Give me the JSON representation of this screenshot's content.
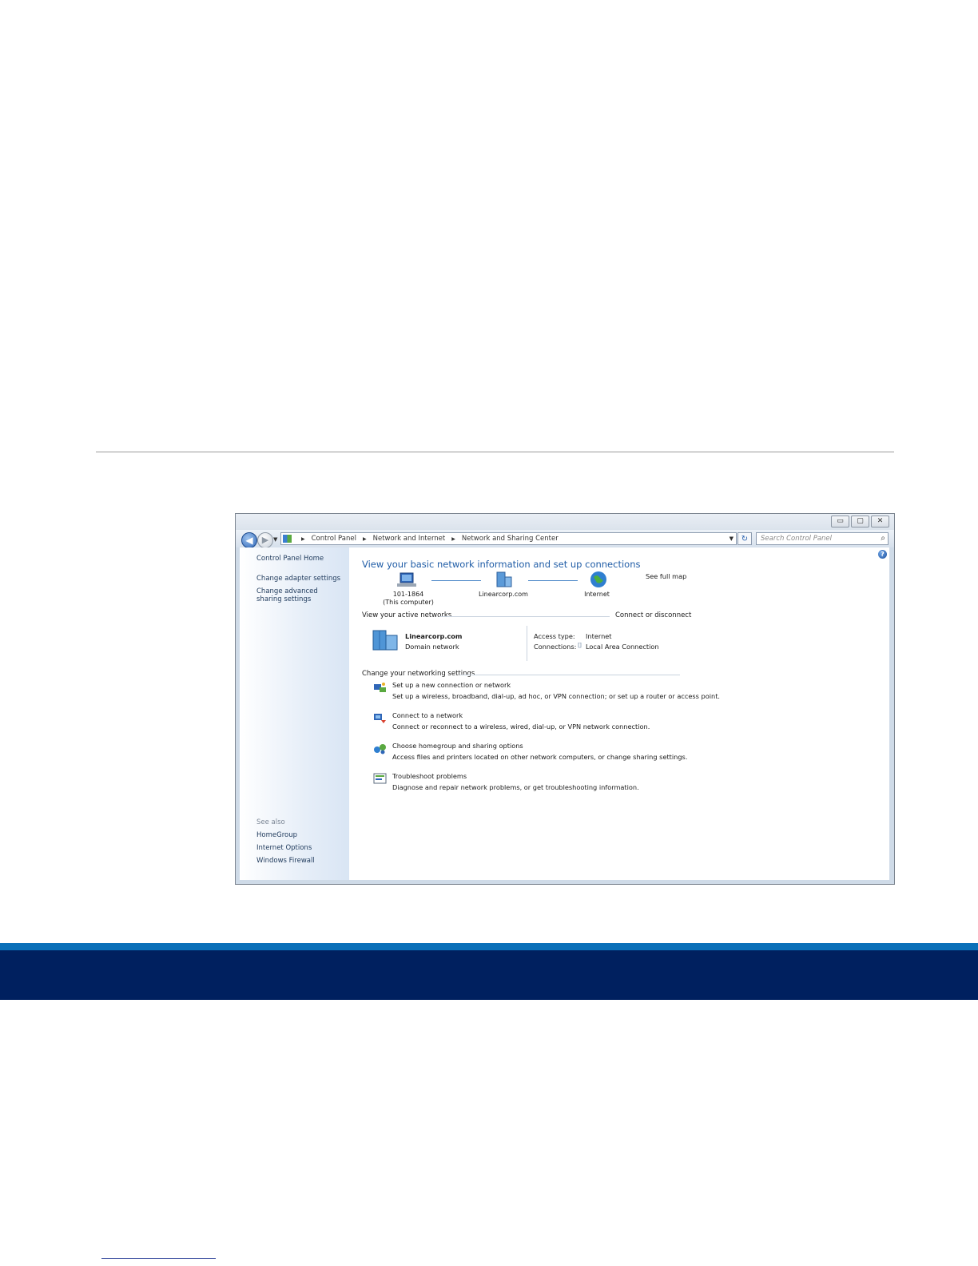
{
  "window": {
    "buttons": {
      "minimize": "▭",
      "maximize": "▢",
      "close": "✕"
    }
  },
  "address": {
    "crumbs": [
      "Control Panel",
      "Network and Internet",
      "Network and Sharing Center"
    ],
    "search_placeholder": "Search Control Panel"
  },
  "sidebar": {
    "home": "Control Panel Home",
    "links": [
      "Change adapter settings",
      "Change advanced sharing settings"
    ],
    "see_also_label": "See also",
    "see_also": [
      "HomeGroup",
      "Internet Options",
      "Windows Firewall"
    ]
  },
  "main": {
    "title": "View your basic network information and set up connections",
    "see_full_map": "See full map",
    "map": {
      "computer_name": "101-1864",
      "computer_sub": "(This computer)",
      "network": "Linearcorp.com",
      "internet": "Internet"
    },
    "active_networks": {
      "label": "View your active networks",
      "connect_link": "Connect or disconnect",
      "network_name": "Linearcorp.com",
      "network_type": "Domain network",
      "access_type_label": "Access type:",
      "access_type_value": "Internet",
      "connections_label": "Connections:",
      "connections_value": "Local Area Connection"
    },
    "settings_label": "Change your networking settings",
    "tasks": [
      {
        "title": "Set up a new connection or network",
        "desc": "Set up a wireless, broadband, dial-up, ad hoc, or VPN connection; or set up a router or access point."
      },
      {
        "title": "Connect to a network",
        "desc": "Connect or reconnect to a wireless, wired, dial-up, or VPN network connection."
      },
      {
        "title": "Choose homegroup and sharing options",
        "desc": "Access files and printers located on other network computers, or change sharing settings."
      },
      {
        "title": "Troubleshoot problems",
        "desc": "Diagnose and repair network problems, or get troubleshooting information."
      }
    ]
  }
}
